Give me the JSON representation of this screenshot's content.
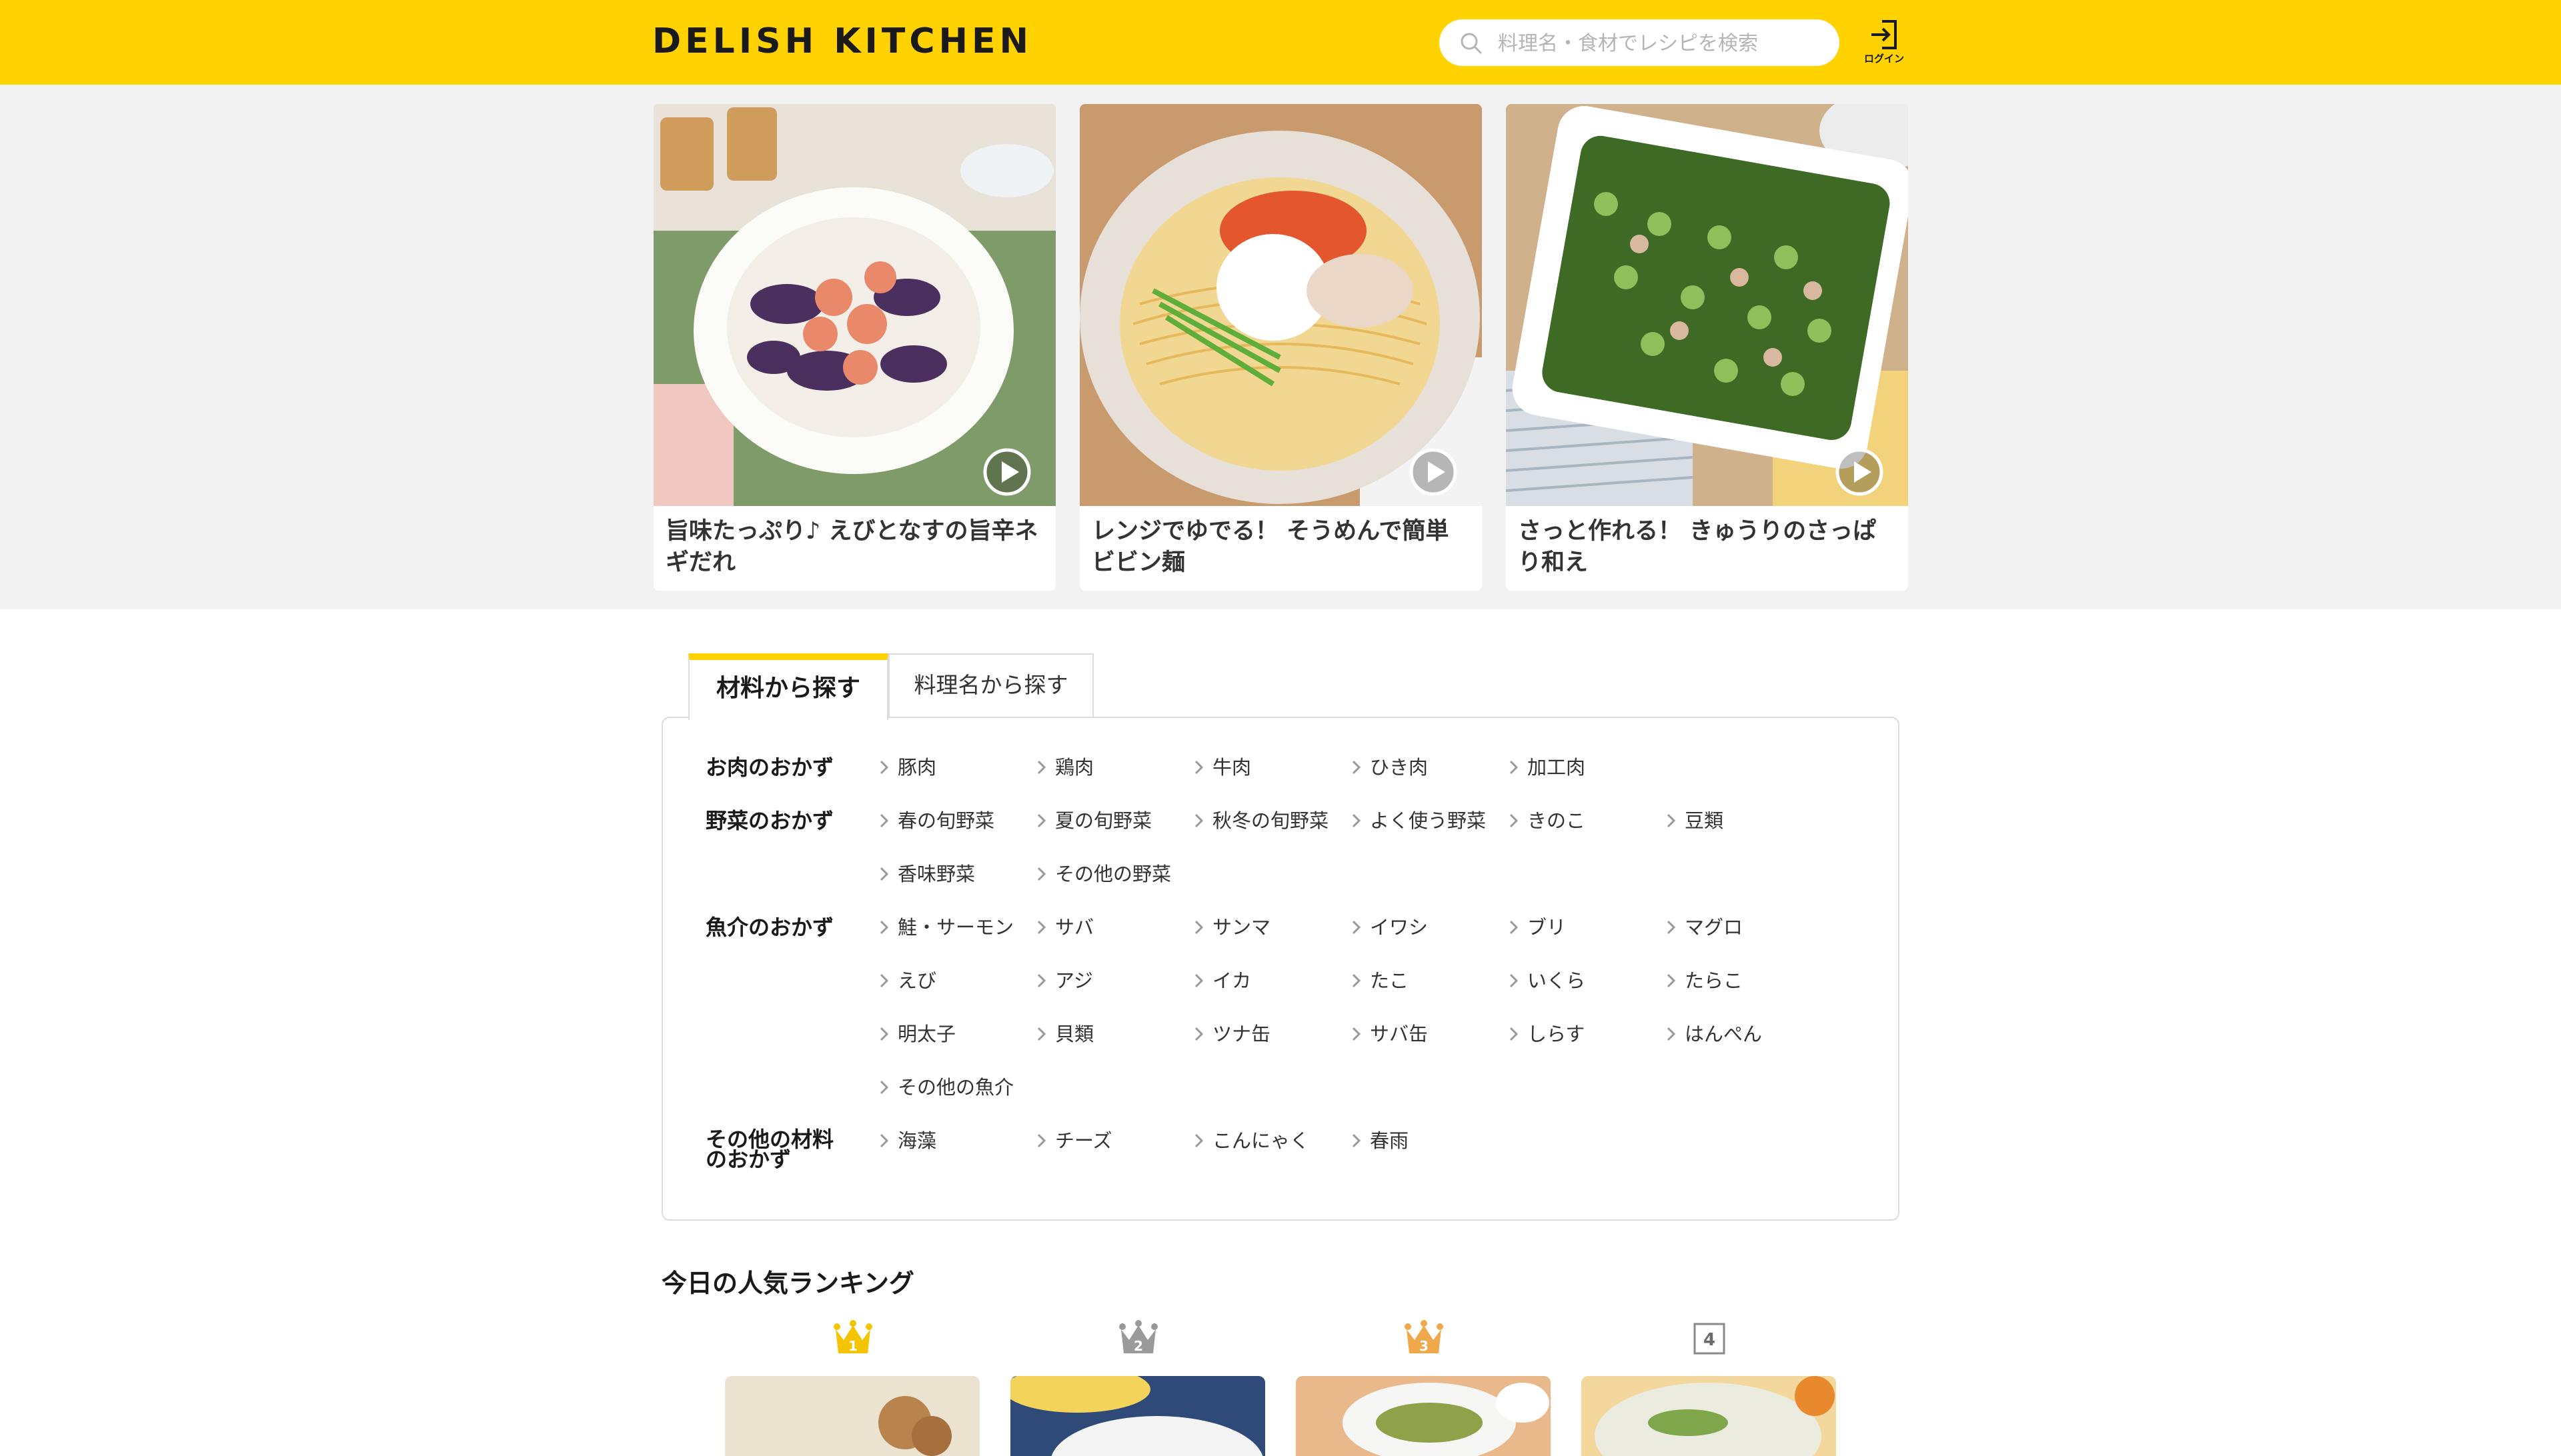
{
  "header": {
    "logo": "DELISH KITCHEN",
    "search_placeholder": "料理名・食材でレシピを検索",
    "login_label": "ログイン"
  },
  "featured": [
    {
      "title": "旨味たっぷり♪ えびとなすの旨辛ネギだれ"
    },
    {
      "title": "レンジでゆでる！ そうめんで簡単ビビン麺"
    },
    {
      "title": "さっと作れる！ きゅうりのさっぱり和え"
    }
  ],
  "tabs": {
    "ingredients": "材料から探す",
    "dish_name": "料理名から探す"
  },
  "categories": {
    "meat": {
      "label": "お肉のおかず",
      "items": [
        "豚肉",
        "鶏肉",
        "牛肉",
        "ひき肉",
        "加工肉"
      ]
    },
    "vegetable": {
      "label": "野菜のおかず",
      "items": [
        "春の旬野菜",
        "夏の旬野菜",
        "秋冬の旬野菜",
        "よく使う野菜",
        "きのこ",
        "豆類",
        "香味野菜",
        "その他の野菜"
      ]
    },
    "seafood": {
      "label": "魚介のおかず",
      "items": [
        "鮭・サーモン",
        "サバ",
        "サンマ",
        "イワシ",
        "ブリ",
        "マグロ",
        "えび",
        "アジ",
        "イカ",
        "たこ",
        "いくら",
        "たらこ",
        "明太子",
        "貝類",
        "ツナ缶",
        "サバ缶",
        "しらす",
        "はんぺん",
        "その他の魚介"
      ]
    },
    "other": {
      "label_line1": "その他の材料",
      "label_line2": "のおかず",
      "items": [
        "海藻",
        "チーズ",
        "こんにゃく",
        "春雨"
      ]
    }
  },
  "ranking": {
    "title": "今日の人気ランキング",
    "ranks": [
      "1",
      "2",
      "3",
      "4"
    ]
  },
  "colors": {
    "brand_yellow": "#ffd200",
    "gold": "#f5c400",
    "silver": "#9a9a9a",
    "bronze": "#f0a94a"
  }
}
